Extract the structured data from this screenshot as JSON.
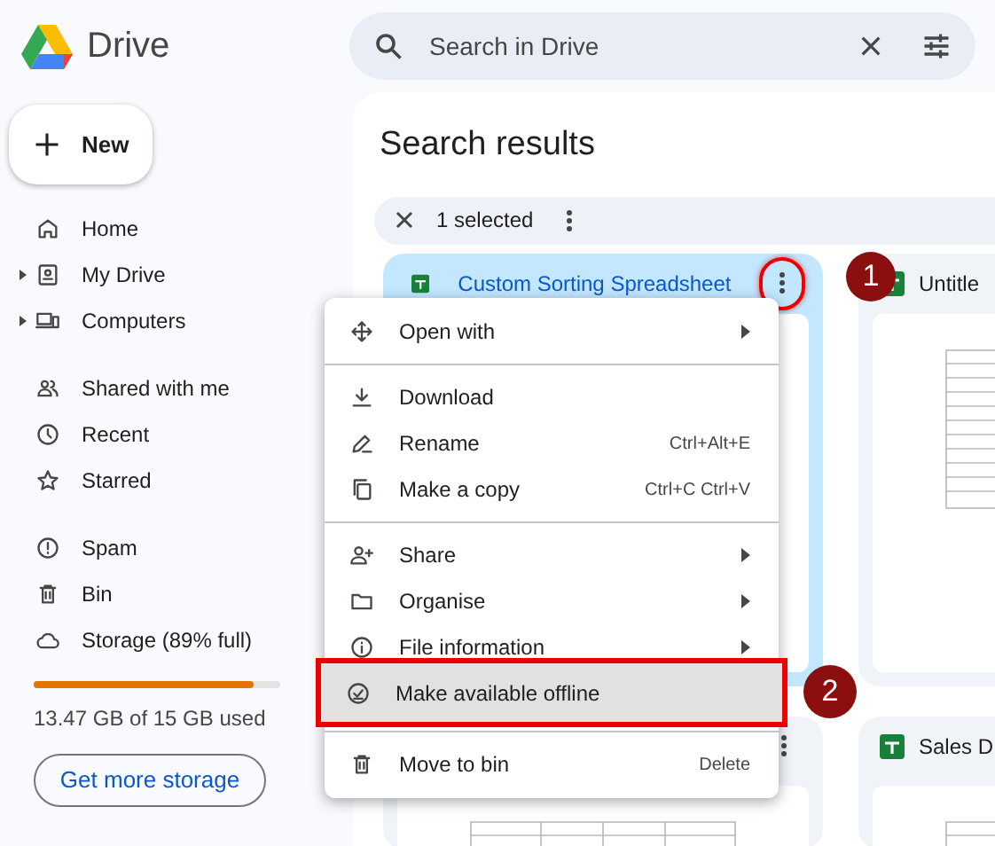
{
  "app": {
    "name": "Drive"
  },
  "search": {
    "placeholder": "Search in Drive"
  },
  "new_button": {
    "label": "New"
  },
  "sidebar": {
    "sections": [
      [
        {
          "label": "Home",
          "expandable": false
        },
        {
          "label": "My Drive",
          "expandable": true
        },
        {
          "label": "Computers",
          "expandable": true
        }
      ],
      [
        {
          "label": "Shared with me",
          "expandable": false
        },
        {
          "label": "Recent",
          "expandable": false
        },
        {
          "label": "Starred",
          "expandable": false
        }
      ],
      [
        {
          "label": "Spam",
          "expandable": false
        },
        {
          "label": "Bin",
          "expandable": false
        },
        {
          "label": "Storage (89% full)",
          "expandable": false
        }
      ]
    ]
  },
  "storage": {
    "level": 0.89,
    "usage": "13.47 GB of 15 GB used",
    "button": "Get more storage"
  },
  "main": {
    "title": "Search results",
    "selection": "1 selected"
  },
  "files": [
    {
      "name": "Custom Sorting Spreadsheet",
      "selected": true,
      "menu_open": true
    },
    {
      "name": "Untitle",
      "selected": false
    },
    {
      "selected": false,
      "menu_open": false
    },
    {
      "name": "Sales D",
      "selected": false
    }
  ],
  "context_menu": [
    {
      "kind": "item",
      "label": "Open with",
      "submenu": true,
      "highlighted": false
    },
    {
      "kind": "divider"
    },
    {
      "kind": "item",
      "label": "Download",
      "submenu": false,
      "highlighted": false
    },
    {
      "kind": "item",
      "label": "Rename",
      "shortcut": "Ctrl+Alt+E",
      "submenu": false,
      "highlighted": false
    },
    {
      "kind": "item",
      "label": "Make a copy",
      "shortcut": "Ctrl+C Ctrl+V",
      "submenu": false,
      "highlighted": false
    },
    {
      "kind": "divider"
    },
    {
      "kind": "item",
      "label": "Share",
      "submenu": true,
      "highlighted": false
    },
    {
      "kind": "item",
      "label": "Organise",
      "submenu": true,
      "highlighted": false
    },
    {
      "kind": "item",
      "label": "File information",
      "submenu": true,
      "highlighted": false
    },
    {
      "kind": "item",
      "label": "Make available offline",
      "submenu": false,
      "highlighted": true
    },
    {
      "kind": "divider"
    },
    {
      "kind": "item",
      "label": "Move to bin",
      "shortcut": "Delete",
      "submenu": false,
      "highlighted": false
    }
  ],
  "callouts": [
    "1",
    "2"
  ]
}
